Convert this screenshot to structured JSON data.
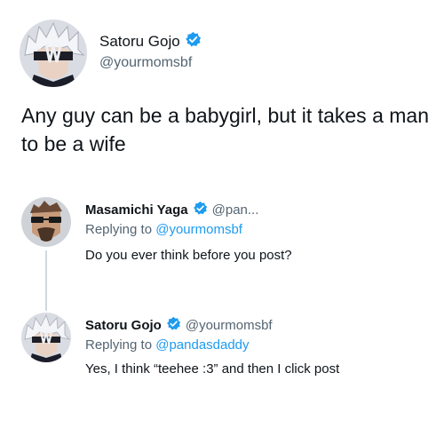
{
  "main_tweet": {
    "author_name": "Satoru Gojo",
    "author_handle": "@yourmomsbf",
    "text": "Any guy can be a babygirl, but it takes a man to be a wife"
  },
  "reply_1": {
    "author_name": "Masamichi Yaga",
    "author_handle": "@pan...",
    "replying_prefix": "Replying to",
    "replying_to": "@yourmomsbf",
    "text": "Do you ever think before you post?"
  },
  "reply_2": {
    "author_name": "Satoru Gojo",
    "author_handle": "@yourmomsbf",
    "replying_prefix": "Replying to",
    "replying_to": "@pandasdaddy",
    "text": "Yes, I think “teehee :3” and then I click post"
  },
  "colors": {
    "verified": "#1d9bf0",
    "mention": "#1d9bf0",
    "handle": "#536471",
    "thread_line": "#cfd9de"
  },
  "icons": [
    "verified-badge-icon",
    "gojo-avatar",
    "yaga-avatar"
  ]
}
